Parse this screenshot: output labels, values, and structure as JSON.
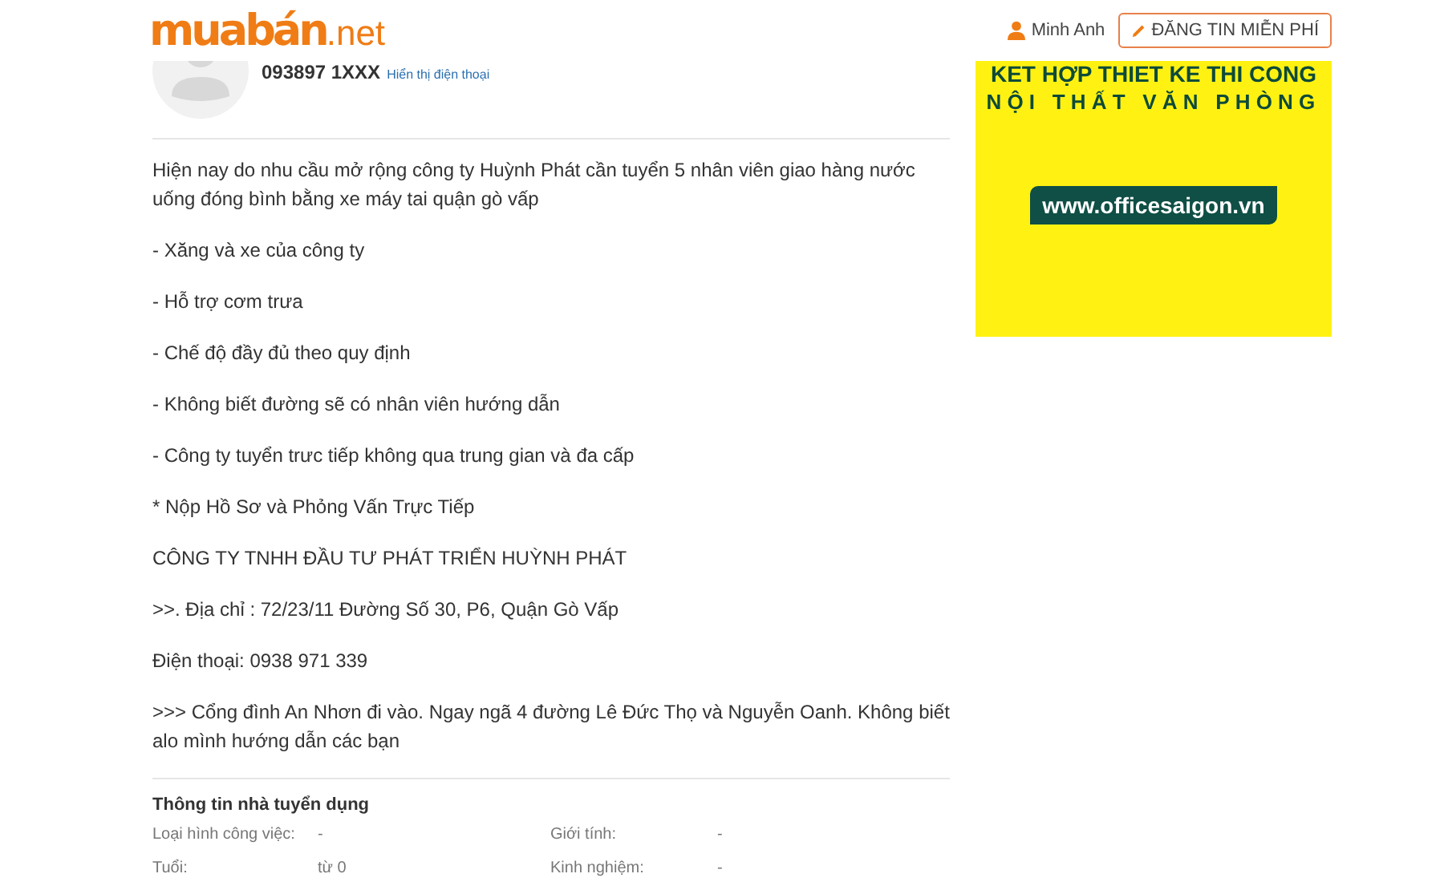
{
  "header": {
    "logo": {
      "brand": "muabán",
      "suffix": ".net"
    },
    "user": "Minh Anh",
    "post_button": "ĐĂNG TIN MIỄN PHÍ"
  },
  "poster": {
    "phone": "093897 1XXX",
    "show_phone": "Hiển thị điện thoại"
  },
  "description": [
    "Hiện nay do nhu cầu mở rộng công ty Huỳnh Phát cần tuyển 5 nhân viên giao hàng nước uống đóng bình bằng xe máy tai quận gò vấp",
    "- Xăng và xe của công ty",
    "- Hỗ trợ cơm trưa",
    "- Chế độ đầy đủ theo quy định",
    "- Không biết đường sẽ có nhân viên hướng dẫn",
    "- Công ty tuyển trưc tiếp không qua trung gian và đa cấp",
    "* Nộp Hồ Sơ và Phỏng Vấn Trực Tiếp",
    "CÔNG TY TNHH ĐẦU TƯ PHÁT TRIỂN HUỲNH PHÁT",
    ">>. Địa chỉ : 72/23/11 Đường Số 30, P6, Quận Gò Vấp",
    "Điện thoại: 0938 971 339",
    ">>> Cổng đình An Nhơn đi vào. Ngay ngã 4 đường Lê Đức Thọ và Nguyễn Oanh. Không biết alo mình hướng dẫn các bạn"
  ],
  "employer_info": {
    "title": "Thông tin nhà tuyển dụng",
    "fields": [
      {
        "label": "Loại hình công việc:",
        "value": "-"
      },
      {
        "label": "Giới tính:",
        "value": "-"
      },
      {
        "label": "Tuổi:",
        "value": "từ 0"
      },
      {
        "label": "Kinh nghiệm:",
        "value": "-"
      }
    ]
  },
  "ad": {
    "headline_1": "KET HỢP THIET KE THI CONG",
    "headline_2": "NỘI THẤT VĂN PHÒNG",
    "url": "www.officesaigon.vn"
  }
}
